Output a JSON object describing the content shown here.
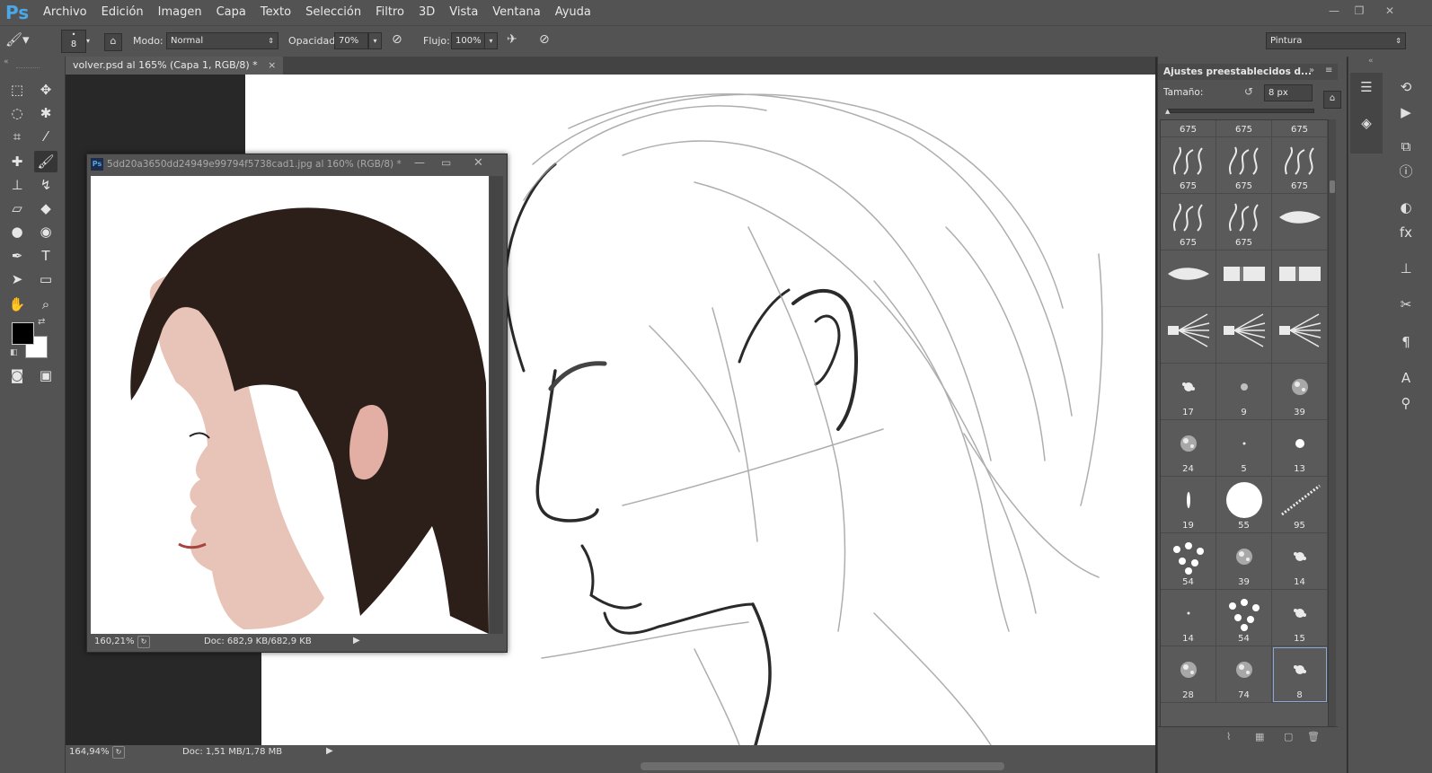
{
  "app": {
    "logo": "Ps"
  },
  "menu": [
    "Archivo",
    "Edición",
    "Imagen",
    "Capa",
    "Texto",
    "Selección",
    "Filtro",
    "3D",
    "Vista",
    "Ventana",
    "Ayuda"
  ],
  "options": {
    "brush_size": "8",
    "mode_label": "Modo:",
    "mode_value": "Normal",
    "opacity_label": "Opacidad:",
    "opacity_value": "70%",
    "flow_label": "Flujo:",
    "flow_value": "100%",
    "workspace": "Pintura"
  },
  "document": {
    "tab_title": "volver.psd al 165% (Capa 1, RGB/8) *",
    "zoom": "164,94%",
    "doc_info": "Doc: 1,51 MB/1,78 MB"
  },
  "floating_window": {
    "title": "5dd20a3650dd24949e99794f5738cad1.jpg al 160% (RGB/8) *",
    "zoom": "160,21%",
    "doc_info": "Doc: 682,9 KB/682,9 KB"
  },
  "brush_panel": {
    "title": "Ajustes preestablecidos d...",
    "size_label": "Tamaño:",
    "size_value": "8 px",
    "brushes": [
      {
        "n": "675",
        "kind": "smoke"
      },
      {
        "n": "675",
        "kind": "smoke"
      },
      {
        "n": "675",
        "kind": "smoke"
      },
      {
        "n": "675",
        "kind": "smoke"
      },
      {
        "n": "675",
        "kind": "smoke"
      },
      {
        "n": "675",
        "kind": "smoke"
      },
      {
        "n": "675",
        "kind": "smoke"
      },
      {
        "n": "675",
        "kind": "smoke"
      },
      {
        "n": "",
        "kind": "bristle"
      },
      {
        "n": "",
        "kind": "bristle"
      },
      {
        "n": "",
        "kind": "flat"
      },
      {
        "n": "",
        "kind": "flat"
      },
      {
        "n": "",
        "kind": "fan"
      },
      {
        "n": "",
        "kind": "fan"
      },
      {
        "n": "",
        "kind": "fan"
      },
      {
        "n": "17",
        "kind": "splat"
      },
      {
        "n": "9",
        "kind": "soft"
      },
      {
        "n": "39",
        "kind": "spray"
      },
      {
        "n": "24",
        "kind": "spray"
      },
      {
        "n": "5",
        "kind": "dot"
      },
      {
        "n": "13",
        "kind": "hard"
      },
      {
        "n": "19",
        "kind": "line"
      },
      {
        "n": "55",
        "kind": "big"
      },
      {
        "n": "95",
        "kind": "chain"
      },
      {
        "n": "54",
        "kind": "dots"
      },
      {
        "n": "39",
        "kind": "spray"
      },
      {
        "n": "14",
        "kind": "splat"
      },
      {
        "n": "14",
        "kind": "dot"
      },
      {
        "n": "54",
        "kind": "dots"
      },
      {
        "n": "15",
        "kind": "splat"
      },
      {
        "n": "28",
        "kind": "spray"
      },
      {
        "n": "74",
        "kind": "spray"
      },
      {
        "n": "8",
        "kind": "splat"
      }
    ],
    "selected_index": 32
  },
  "colors": {
    "ui": "#535353",
    "dark": "#282828",
    "accent": "#4aa8e8"
  }
}
